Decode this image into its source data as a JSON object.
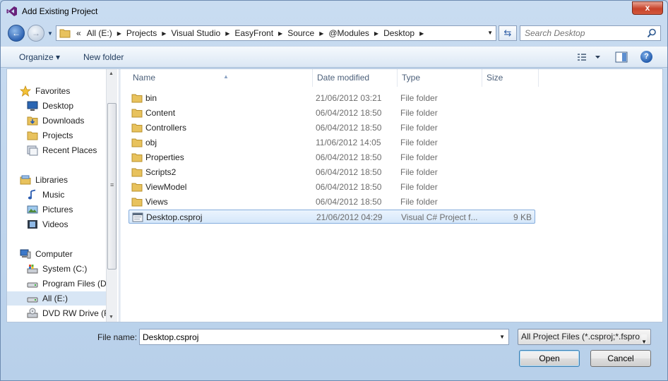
{
  "window": {
    "title": "Add Existing Project",
    "close_label": "x"
  },
  "address": {
    "overflow_label": "«",
    "crumbs": [
      "All (E:)",
      "Projects",
      "Visual Studio",
      "EasyFront",
      "Source",
      "@Modules",
      "Desktop"
    ],
    "search_placeholder": "Search Desktop"
  },
  "toolbar": {
    "organize_label": "Organize ▾",
    "new_folder_label": "New folder",
    "help_label": "?"
  },
  "nav": {
    "groups": [
      {
        "label": "Favorites",
        "icon": "star-icon"
      },
      {
        "label": "Desktop",
        "icon": "desktop-icon"
      },
      {
        "label": "Downloads",
        "icon": "downloads-icon"
      },
      {
        "label": "Projects",
        "icon": "folder-icon"
      },
      {
        "label": "Recent Places",
        "icon": "recent-places-icon"
      },
      {
        "label": "Libraries",
        "icon": "libraries-icon"
      },
      {
        "label": "Music",
        "icon": "music-icon"
      },
      {
        "label": "Pictures",
        "icon": "pictures-icon"
      },
      {
        "label": "Videos",
        "icon": "videos-icon"
      },
      {
        "label": "Computer",
        "icon": "computer-icon"
      },
      {
        "label": "System (C:)",
        "icon": "system-drive-icon"
      },
      {
        "label": "Program Files (D:",
        "icon": "drive-icon"
      },
      {
        "label": "All (E:)",
        "icon": "drive-icon"
      },
      {
        "label": "DVD RW Drive (F:",
        "icon": "dvd-drive-icon"
      }
    ]
  },
  "columns": {
    "name": "Name",
    "date": "Date modified",
    "type": "Type",
    "size": "Size"
  },
  "files": [
    {
      "name": "bin",
      "date": "21/06/2012 03:21",
      "type": "File folder",
      "size": "",
      "icon": "folder-icon"
    },
    {
      "name": "Content",
      "date": "06/04/2012 18:50",
      "type": "File folder",
      "size": "",
      "icon": "folder-icon"
    },
    {
      "name": "Controllers",
      "date": "06/04/2012 18:50",
      "type": "File folder",
      "size": "",
      "icon": "folder-icon"
    },
    {
      "name": "obj",
      "date": "11/06/2012 14:05",
      "type": "File folder",
      "size": "",
      "icon": "folder-icon"
    },
    {
      "name": "Properties",
      "date": "06/04/2012 18:50",
      "type": "File folder",
      "size": "",
      "icon": "folder-icon"
    },
    {
      "name": "Scripts2",
      "date": "06/04/2012 18:50",
      "type": "File folder",
      "size": "",
      "icon": "folder-icon"
    },
    {
      "name": "ViewModel",
      "date": "06/04/2012 18:50",
      "type": "File folder",
      "size": "",
      "icon": "folder-icon"
    },
    {
      "name": "Views",
      "date": "06/04/2012 18:50",
      "type": "File folder",
      "size": "",
      "icon": "folder-icon"
    },
    {
      "name": "Desktop.csproj",
      "date": "21/06/2012 04:29",
      "type": "Visual C# Project f...",
      "size": "9 KB",
      "icon": "csproj-file-icon"
    }
  ],
  "bottom": {
    "file_name_label": "File name:",
    "file_name_value": "Desktop.csproj",
    "filter_value": "All Project Files (*.csproj;*.fspro",
    "open_label": "Open",
    "cancel_label": "Cancel"
  }
}
